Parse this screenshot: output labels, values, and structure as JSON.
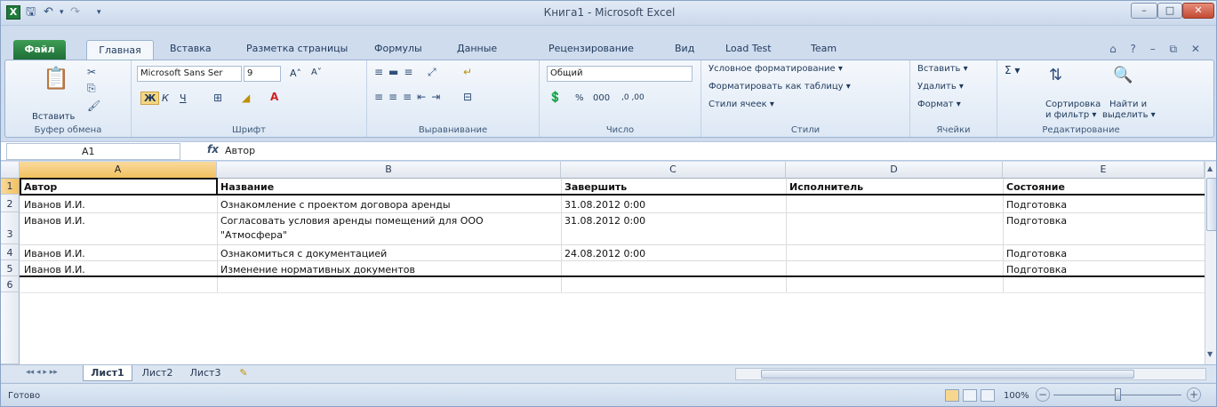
{
  "window": {
    "title": "Книга1  -  Microsoft Excel",
    "minimize": "–",
    "maximize": "□",
    "close": "✕"
  },
  "qat": {
    "undo": "↶",
    "redo": "↷",
    "dropdown": "▾"
  },
  "ribbon_tabs": {
    "file": "Файл",
    "home": "Главная",
    "insert": "Вставка",
    "layout": "Разметка страницы",
    "formulas": "Формулы",
    "data": "Данные",
    "review": "Рецензирование",
    "view": "Вид",
    "loadtest": "Load Test",
    "team": "Team",
    "help_icons": "⌂ ? – ⧉ ✕"
  },
  "ribbon": {
    "clipboard": {
      "label": "Буфер обмена",
      "paste": "Вставить"
    },
    "font": {
      "label": "Шрифт",
      "name": "Microsoft Sans Ser",
      "size": "9",
      "bold": "Ж",
      "italic": "К",
      "underline": "Ч",
      "grow": "A˄",
      "shrink": "A˅"
    },
    "align": {
      "label": "Выравнивание"
    },
    "number": {
      "label": "Число",
      "format": "Общий",
      "percent": "%",
      "thousands": "000",
      "inc": ",0 ,00",
      "dec": ",00 ,0"
    },
    "styles": {
      "label": "Стили",
      "conditional": "Условное форматирование ▾",
      "as_table": "Форматировать как таблицу ▾",
      "cell_styles": "Стили ячеек ▾"
    },
    "cells": {
      "label": "Ячейки",
      "insert": "Вставить ▾",
      "delete": "Удалить ▾",
      "format": "Формат ▾"
    },
    "editing": {
      "label": "Редактирование",
      "sum": "Σ ▾",
      "sort": "Сортировка\nи фильтр ▾",
      "sort1": "Сортировка",
      "sort2": "и фильтр ▾",
      "find1": "Найти и",
      "find2": "выделить ▾"
    }
  },
  "formula_bar": {
    "name_box": "A1",
    "fx": "fx",
    "value": "Автор"
  },
  "grid": {
    "columns": [
      "A",
      "B",
      "C",
      "D",
      "E"
    ],
    "rows": [
      "1",
      "2",
      "3",
      "4",
      "5",
      "6"
    ],
    "header_row": [
      "Автор",
      "Название",
      "Завершить",
      "Исполнитель",
      "Состояние"
    ],
    "data": [
      [
        "Иванов И.И.",
        "Ознакомление с проектом договора аренды",
        "31.08.2012 0:00",
        "",
        "Подготовка"
      ],
      [
        "Иванов И.И.",
        "Согласовать условия аренды помещений для ООО",
        "31.08.2012 0:00",
        "",
        "Подготовка"
      ],
      [
        "Иванов И.И.",
        "Ознакомиться с документацией",
        "24.08.2012 0:00",
        "",
        "Подготовка"
      ],
      [
        "Иванов И.И.",
        "Изменение нормативных документов",
        "",
        "",
        "Подготовка"
      ]
    ],
    "row3_line2": "\"Атмосфера\""
  },
  "sheets": {
    "nav": "◂◂ ◂ ▸ ▸▸",
    "tabs": [
      "Лист1",
      "Лист2",
      "Лист3"
    ],
    "add": "✎"
  },
  "status": {
    "ready": "Готово",
    "zoom": "100%",
    "zoom_minus": "−",
    "zoom_plus": "+"
  },
  "colors": {
    "file_tab": "#2f8a46",
    "selection": "#f1c15f",
    "ribbon_bg": "#dde8f5"
  }
}
